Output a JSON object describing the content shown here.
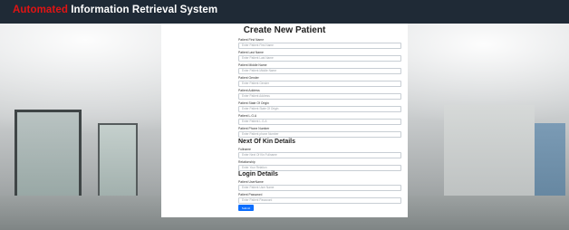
{
  "navbar": {
    "brand_accent": "Automated",
    "brand_rest": " Information Retrieval System"
  },
  "form": {
    "title": "Create New Patient",
    "fields": [
      {
        "label": "Patient First Name",
        "placeholder": "Enter Patient First Name"
      },
      {
        "label": "Patient Last Name",
        "placeholder": "Enter Patient Last Name"
      },
      {
        "label": "Patient Middle Name",
        "placeholder": "Enter Patient Middle Name"
      },
      {
        "label": "Patient Gender",
        "placeholder": "Enter Patient Gender"
      },
      {
        "label": "Patient Address",
        "placeholder": "Enter Patient Address"
      },
      {
        "label": "Patient State Of Origin",
        "placeholder": "Enter Patient State Of Origin"
      },
      {
        "label": "Patient L.G.A",
        "placeholder": "Enter Patient L.G.A"
      },
      {
        "label": "Patient Phone Number",
        "placeholder": "Enter Patient phone Number"
      }
    ],
    "kin_heading": "Next Of Kin Details",
    "kin_fields": [
      {
        "label": "Fullname",
        "placeholder": "Enter Next Of Kin Fullname"
      },
      {
        "label": "Relationship",
        "placeholder": "Enter Your Relation"
      }
    ],
    "login_heading": "Login Details",
    "login_fields": [
      {
        "label": "Patient UserName",
        "placeholder": "Enter Patient User Name"
      },
      {
        "label": "Patient Password",
        "placeholder": "Enter Patient Password"
      }
    ],
    "submit_label": "Submit"
  },
  "colors": {
    "navbar_bg": "#1f2a36",
    "brand_accent": "#e01414",
    "submit_bg": "#0d6efd"
  }
}
